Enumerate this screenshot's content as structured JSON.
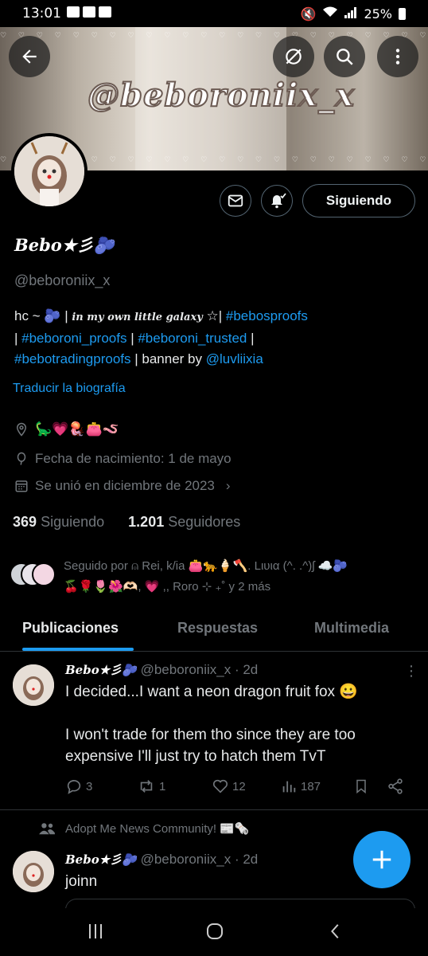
{
  "status_bar": {
    "time": "13:01",
    "battery": "25%"
  },
  "banner": {
    "heading": "@beboroniix_x",
    "hearts": "♡ ♡ ♡ ♡ ♡ ♡ ♡ ♡ ♡ ♡ ♡ ♡ ♡ ♡ ♡ ♡ ♡ ♡ ♡ ♡ ♡ ♡ ♡ ♡ ♡ ♡ ♡ ♡ ♡ ♡"
  },
  "header": {
    "follow_label": "Siguiendo"
  },
  "profile": {
    "name": "Bebo★彡🫐",
    "handle": "@beboroniix_x",
    "bio": {
      "prefix": "hc ~ 🫐 | ",
      "fancy": "in my own little galaxy",
      "star": " ☆| ",
      "tag1": "#bebosproofs",
      "sep1": "| ",
      "tag2": "#beboroni_proofs",
      "sep2": " | ",
      "tag3": "#beboroni_trusted",
      "sep3": " |",
      "tag4": "#bebotradingproofs",
      "sep4": " | banner by ",
      "mention": "@luvliixia"
    },
    "translate": "Traducir la biografía",
    "location": "🦕💗🪼👛🪱",
    "birthday": "Fecha de nacimiento: 1 de mayo",
    "joined": "Se unió en diciembre de 2023",
    "following_count": "369",
    "following_label": "Siguiendo",
    "followers_count": "1.201",
    "followers_label": "Seguidores",
    "followed_by_line1": "Seguido por ⍝ Rei, k/ia 👛🐆🍦🪓. Lιυια (^. .^)ʃ ☁️🫐",
    "followed_by_line2": "🍒🌹🌷🌺🫶🏻, 💗 ,, Roro ⊹ ₊˚ y 2 más"
  },
  "tabs": [
    "Publicaciones",
    "Respuestas",
    "Multimedia"
  ],
  "posts": [
    {
      "name": "Bebo★彡🫐",
      "handle": "@beboroniix_x",
      "time": "2d",
      "line1": "I decided...I want a neon dragon fruit fox 😀",
      "line2": "I won't trade for them tho since they are too",
      "line3": "expensive I'll just try to hatch them TvT",
      "replies": "3",
      "reposts": "1",
      "likes": "12",
      "views": "187"
    },
    {
      "community": "Adopt Me News Community! 📰🗞️",
      "name": "Bebo★彡🫐",
      "handle": "@beboroniix_x",
      "time": "2d",
      "text": "joinn"
    }
  ],
  "colors": {
    "accent": "#1d9bf0",
    "muted": "#71767b",
    "border": "#2f3336"
  }
}
